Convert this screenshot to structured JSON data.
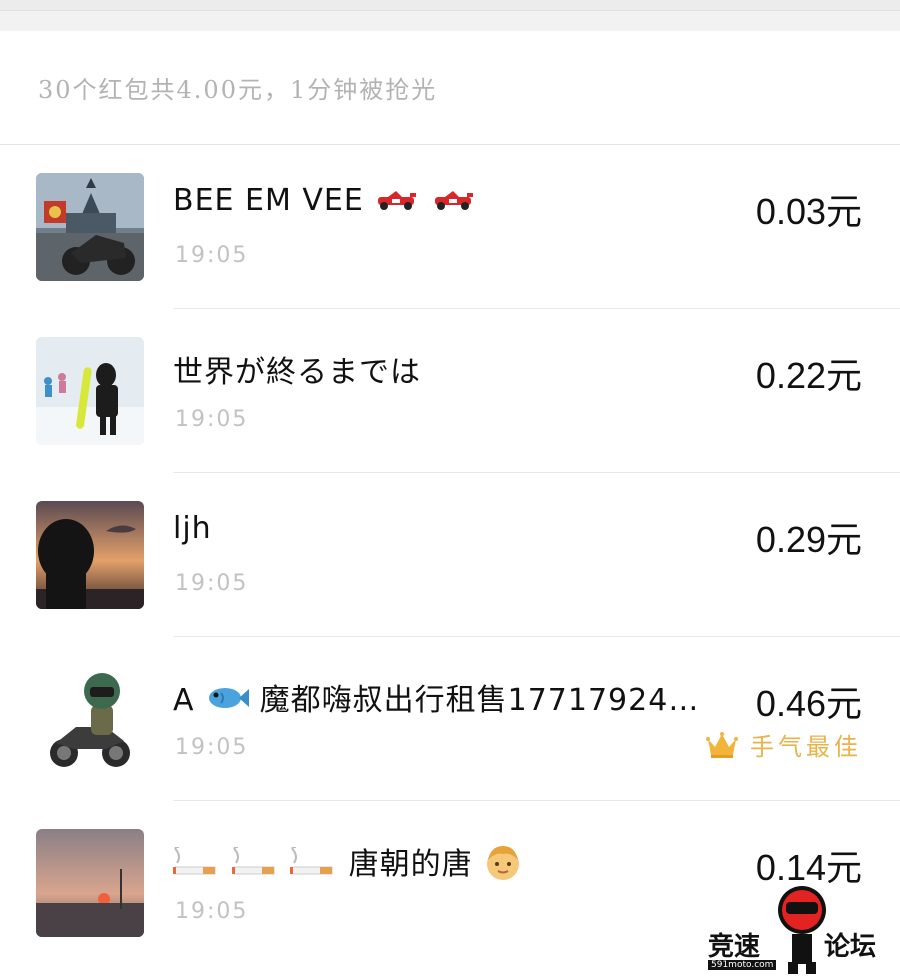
{
  "summary": "30个红包共4.00元，1分钟被抢光",
  "records": [
    {
      "name": "BEE EM VEE",
      "name_suffix_emoji": "racing-car-icon x2",
      "time": "19:05",
      "amount": "0.03元"
    },
    {
      "name": "世界が終るまでは",
      "time": "19:05",
      "amount": "0.22元"
    },
    {
      "name": "ljh",
      "time": "19:05",
      "amount": "0.29元"
    },
    {
      "name_prefix": "A",
      "name_prefix_emoji": "fish-icon",
      "name": "魔都嗨叔出行租售17717924…",
      "time": "19:05",
      "amount": "0.46元",
      "badge": "手气最佳"
    },
    {
      "name_prefix_emoji": "cigarette-icon x3",
      "name": "唐朝的唐",
      "name_suffix_emoji": "boy-face-icon",
      "time": "19:05",
      "amount": "0.14元"
    }
  ],
  "watermark": {
    "left": "竞速",
    "right": "论坛",
    "site": "591moto.com"
  },
  "colors": {
    "best_badge": "#e9b34a",
    "summary_text": "#b3b3b3",
    "time_text": "#c2c2c2"
  }
}
